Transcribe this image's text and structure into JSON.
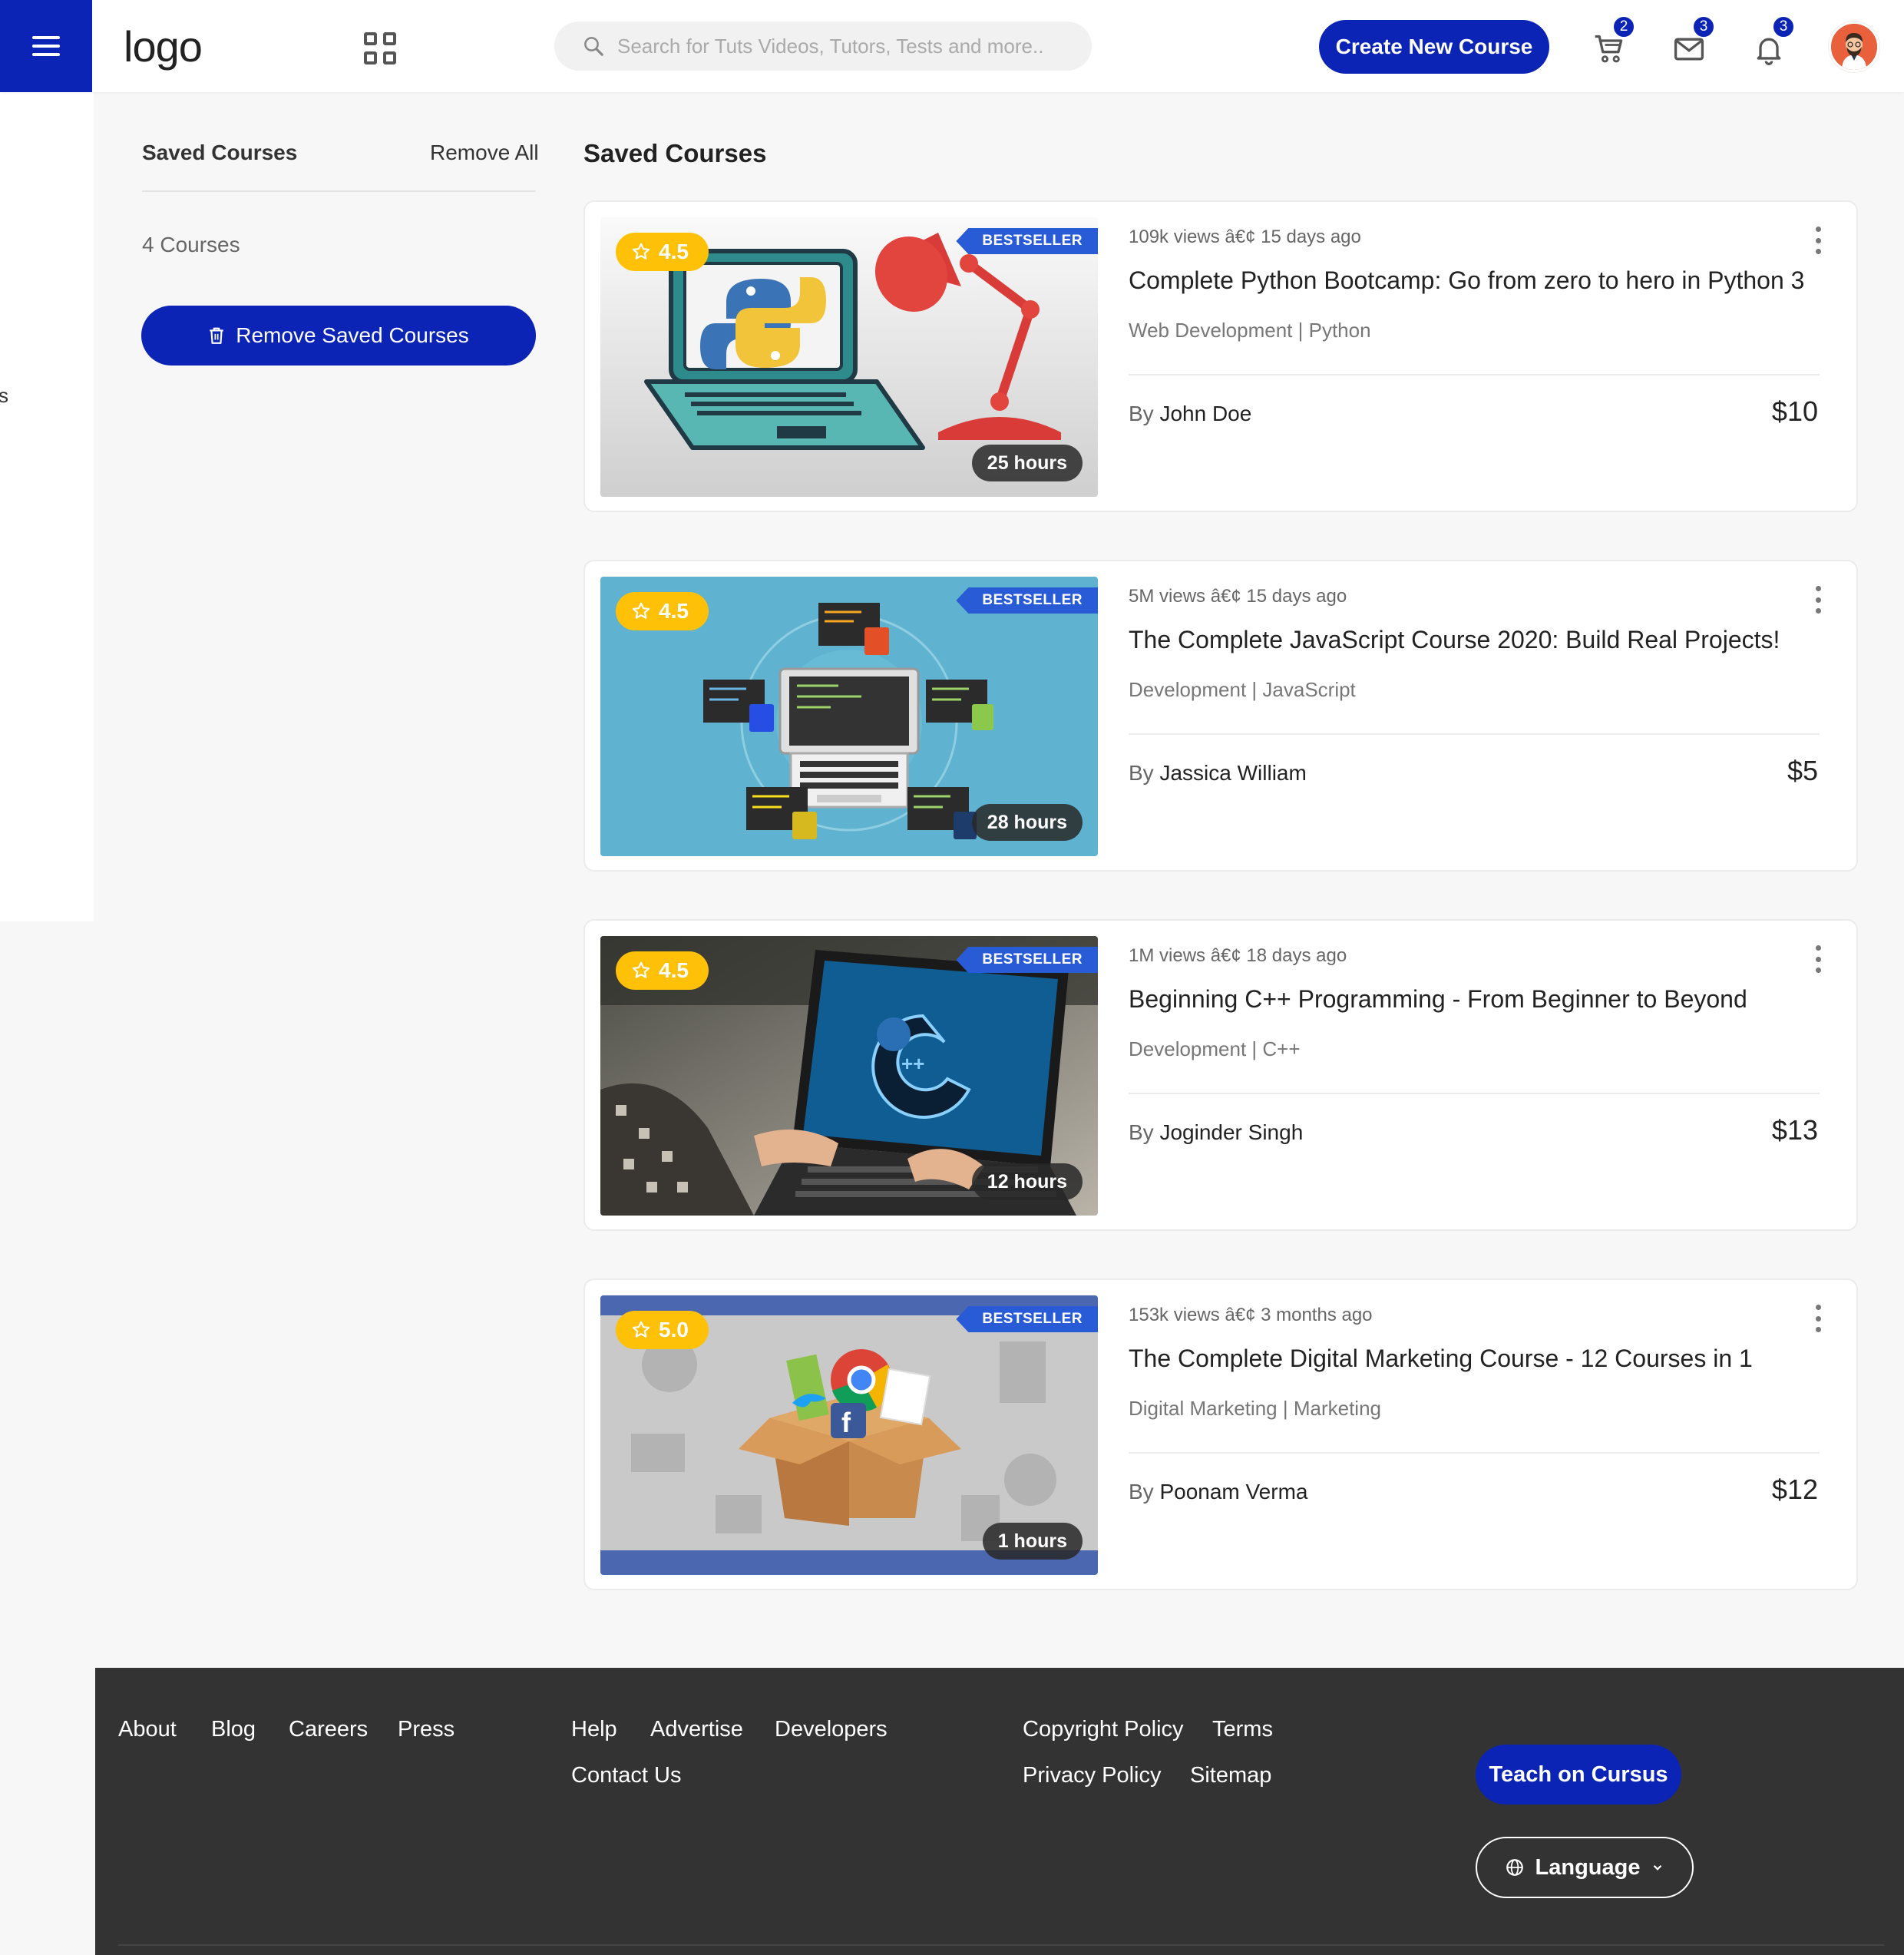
{
  "header": {
    "logo": "logo",
    "search_placeholder": "Search for Tuts Videos, Tutors, Tests and more..",
    "create_button": "Create New Course",
    "cart_count": "2",
    "messages_count": "3",
    "notifications_count": "3"
  },
  "sidebar": {
    "partial_letter": "s"
  },
  "left_panel": {
    "title": "Saved Courses",
    "remove_all": "Remove All",
    "count": "4 Courses",
    "remove_button": "Remove Saved Courses"
  },
  "main": {
    "title": "Saved Courses",
    "courses": [
      {
        "rating": "4.5",
        "badge": "BESTSELLER",
        "hours": "25 hours",
        "meta": "109k views â€¢  15 days ago",
        "title": "Complete Python Bootcamp: Go from zero to hero in Python 3",
        "category": "Web Development | Python",
        "by": "By",
        "author": "John Doe",
        "price": "$10"
      },
      {
        "rating": "4.5",
        "badge": "BESTSELLER",
        "hours": "28 hours",
        "meta": "5M views â€¢  15 days ago",
        "title": "The Complete JavaScript Course 2020: Build Real Projects!",
        "category": "Development | JavaScript",
        "by": "By",
        "author": "Jassica William",
        "price": "$5"
      },
      {
        "rating": "4.5",
        "badge": "BESTSELLER",
        "hours": "12 hours",
        "meta": "1M views â€¢  18 days ago",
        "title": "Beginning C++ Programming - From Beginner to Beyond",
        "category": "Development | C++",
        "by": "By",
        "author": "Joginder Singh",
        "price": "$13"
      },
      {
        "rating": "5.0",
        "badge": "BESTSELLER",
        "hours": "1 hours",
        "meta": "153k views â€¢  3 months ago",
        "title": "The Complete Digital Marketing Course - 12 Courses in 1",
        "category": "Digital Marketing | Marketing",
        "by": "By",
        "author": "Poonam Verma",
        "price": "$12"
      }
    ]
  },
  "footer": {
    "col1": [
      "About",
      "Blog",
      "Careers",
      "Press"
    ],
    "col2": [
      "Help",
      "Advertise",
      "Developers",
      "Contact Us"
    ],
    "col3": [
      "Copyright Policy",
      "Terms",
      "Privacy Policy",
      "Sitemap"
    ],
    "teach_button": "Teach on Cursus",
    "language_button": "Language"
  },
  "colors": {
    "primary": "#0b24b5",
    "rating": "#ffc107",
    "bestseller": "#2a5bd7",
    "footer_bg": "#333333"
  },
  "icons": [
    "menu-icon",
    "grid-icon",
    "search-icon",
    "cart-icon",
    "mail-icon",
    "bell-icon",
    "avatar",
    "star-icon",
    "trash-icon",
    "more-vertical-icon",
    "globe-icon",
    "chevron-down-icon"
  ]
}
